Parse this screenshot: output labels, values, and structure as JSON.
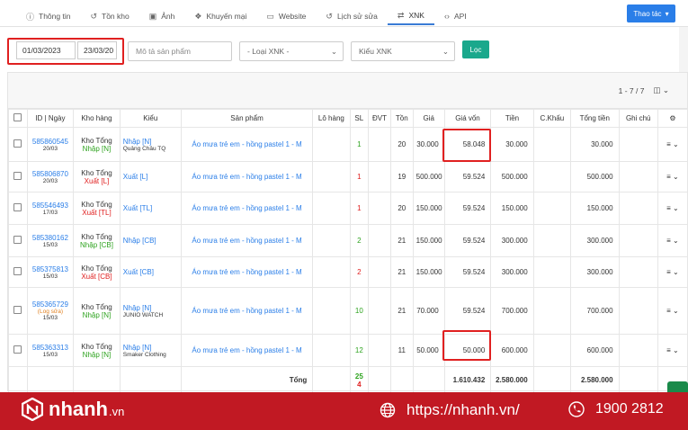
{
  "tabs": [
    {
      "label": "Thông tin",
      "icon": "info-icon"
    },
    {
      "label": "Tồn kho",
      "icon": "history-icon"
    },
    {
      "label": "Ảnh",
      "icon": "image-icon"
    },
    {
      "label": "Khuyến mại",
      "icon": "gift-icon"
    },
    {
      "label": "Website",
      "icon": "monitor-icon"
    },
    {
      "label": "Lịch sử sửa",
      "icon": "history-icon"
    },
    {
      "label": "XNK",
      "icon": "exchange-icon"
    },
    {
      "label": "API",
      "icon": "code-icon"
    }
  ],
  "active_tab": "XNK",
  "actions_label": "Thao tác",
  "filters": {
    "date_from": "01/03/2023",
    "date_to": "23/03/20",
    "product_placeholder": "Mô tả sản phẩm",
    "type_select": "- Loại XNK -",
    "kind_select": "Kiểu XNK",
    "filter_button": "Lọc"
  },
  "pager": {
    "range": "1 - 7 / 7"
  },
  "columns": [
    "ID | Ngày",
    "Kho hàng",
    "Kiểu",
    "Sản phẩm",
    "Lô hàng",
    "SL",
    "ĐVT",
    "Tồn",
    "Giá",
    "Giá vốn",
    "Tiền",
    "C.Khấu",
    "Tổng tiền",
    "Ghi chú"
  ],
  "rows": [
    {
      "id": "585860545",
      "note": "",
      "date": "20/03",
      "store": "Kho Tổng",
      "kind": "Nhập [N]",
      "type": "Nhập [N]",
      "source": "Quảng Châu TQ",
      "product": "Áo mưa trẻ em - hồng pastel 1 - M",
      "qty": "1",
      "stock": "20",
      "price": "30.000",
      "cost": "58.048",
      "amount": "30.000",
      "total": "30.000"
    },
    {
      "id": "585806870",
      "note": "",
      "date": "20/03",
      "store": "Kho Tổng",
      "kind": "Xuất [L]",
      "type": "Xuất [L]",
      "source": "",
      "product": "Áo mưa trẻ em - hồng pastel 1 - M",
      "qty": "1",
      "stock": "19",
      "price": "500.000",
      "cost": "59.524",
      "amount": "500.000",
      "total": "500.000"
    },
    {
      "id": "585546493",
      "note": "",
      "date": "17/03",
      "store": "Kho Tổng",
      "kind": "Xuất [TL]",
      "type": "Xuất [TL]",
      "source": "",
      "product": "Áo mưa trẻ em - hồng pastel 1 - M",
      "qty": "1",
      "stock": "20",
      "price": "150.000",
      "cost": "59.524",
      "amount": "150.000",
      "total": "150.000"
    },
    {
      "id": "585380162",
      "note": "",
      "date": "15/03",
      "store": "Kho Tổng",
      "kind": "Nhập [CB]",
      "type": "Nhập [CB]",
      "source": "",
      "product": "Áo mưa trẻ em - hồng pastel 1 - M",
      "qty": "2",
      "stock": "21",
      "price": "150.000",
      "cost": "59.524",
      "amount": "300.000",
      "total": "300.000"
    },
    {
      "id": "585375813",
      "note": "",
      "date": "15/03",
      "store": "Kho Tổng",
      "kind": "Xuất [CB]",
      "type": "Xuất [CB]",
      "source": "",
      "product": "Áo mưa trẻ em - hồng pastel 1 - M",
      "qty": "2",
      "stock": "21",
      "price": "150.000",
      "cost": "59.524",
      "amount": "300.000",
      "total": "300.000"
    },
    {
      "id": "585365729",
      "note": "(Log sửa)",
      "date": "15/03",
      "store": "Kho Tổng",
      "kind": "Nhập [N]",
      "type": "Nhập [N]",
      "source": "JUNIO WATCH",
      "product": "Áo mưa trẻ em - hồng pastel 1 - M",
      "qty": "10",
      "stock": "21",
      "price": "70.000",
      "cost": "59.524",
      "amount": "700.000",
      "total": "700.000"
    },
    {
      "id": "585363313",
      "note": "",
      "date": "15/03",
      "store": "Kho Tổng",
      "kind": "Nhập [N]",
      "type": "Nhập [N]",
      "source": "Smaker Clothing",
      "product": "Áo mưa trẻ em - hồng pastel 1 - M",
      "qty": "12",
      "stock": "11",
      "price": "50.000",
      "cost": "50.000",
      "amount": "600.000",
      "total": "600.000"
    }
  ],
  "totals": {
    "label": "Tổng",
    "qty_green": "25",
    "qty_red": "4",
    "cost": "1.610.432",
    "amount": "2.580.000",
    "total": "2.580.000"
  },
  "footer": {
    "brand": "nhanh",
    "brand_suffix": ".vn",
    "url": "https://nhanh.vn/",
    "phone": "1900 2812"
  },
  "colors": {
    "accent": "#2a7ee8",
    "brand_red": "#c11923",
    "green": "#2ea31f",
    "red": "#e02020",
    "filter_button": "#1aa88c"
  }
}
